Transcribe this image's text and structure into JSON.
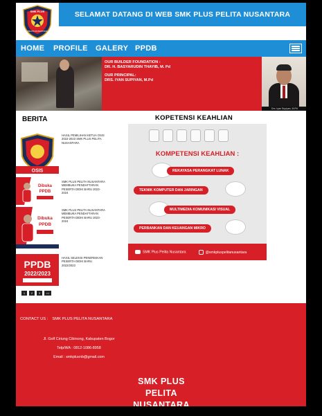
{
  "header": {
    "title": "SELAMAT DATANG DI WEB SMK PLUS PELITA NUSANTARA",
    "logo_text_top": "SMK PLUS",
    "logo_text_bottom": "PELITA NUSANTARA"
  },
  "nav": {
    "items": [
      "HOME",
      "PROFILE",
      "GALERY",
      "PPDB"
    ],
    "menu_icon": "hamburger-menu-icon"
  },
  "hero": {
    "founder_label": "OUR BUILDER FOUNDATION :",
    "founder_name": "DR. H. BASYARUDIN THAYIB, M. Pd",
    "principal_label": "OUR PRINCIPAL:",
    "principal_name": "DRS. IYAN SUPIYAN, M.Pd",
    "photo_caption": "Drs. Iyan Supiyan, M.Pd"
  },
  "berita": {
    "title": "BERITA",
    "items": [
      {
        "text": "HASIL PEMILIHAN KETUA OSIS 2022-2023 SMK PLUS PELITA NUSANTARA",
        "thumb_label": "OSIS"
      },
      {
        "text": "SMK PLUS PELITA NUSANTARA MEMBUKA PENDAFTARAN PESERTA DIDIK BARU 2023-2024",
        "thumb_label": "Telah Dibuka PPDB"
      },
      {
        "text": "SMK PLUS PELITA NUSANTARA MEMBUKA PENDAFTARAN PESERTA DIDIK BARU 2023-2024",
        "thumb_label": "Telah Dibuka PPDB"
      },
      {
        "text": "HASIL SELEKSI PENERIMAAN PESERTA DIDIK BARU 2022/2023",
        "thumb_label": "PPDB 2022/2023"
      }
    ],
    "pager": [
      "1",
      "2",
      "3",
      ">>"
    ]
  },
  "kompetensi": {
    "title": "KOPETENSI KEAHLIAN",
    "poster_heading": "KOMPETENSI KEAHLIAN :",
    "skills": [
      "REKAYASA PERANGKAT LUNAK",
      "TEKNIK KOMPUTER DAN JARINGAN",
      "MULTIMEDIA KOMUNIKASI VISUAL",
      "PERBANKAN DAN KEUANGAN MIKRO"
    ],
    "youtube": "SMK Plus Pelita Nusantara",
    "instagram": "@smkpluspelitanusantara"
  },
  "footer": {
    "contact_label": "CONTACT US :",
    "contact_school": "SMK PLUS PELITA NUSANTARA",
    "address": "Jl. Golf Ciriung Cibinong, Kabupaten Bogor",
    "phone": "Telp/WA : 0812-1086-8958",
    "email": "Email : smkplusnb@gmail.com",
    "name_line1": "SMK PLUS",
    "name_line2": "PELITA",
    "name_line3": "NUSANTARA"
  },
  "colors": {
    "brand_blue": "#1e8fd6",
    "brand_red": "#d61f26"
  }
}
